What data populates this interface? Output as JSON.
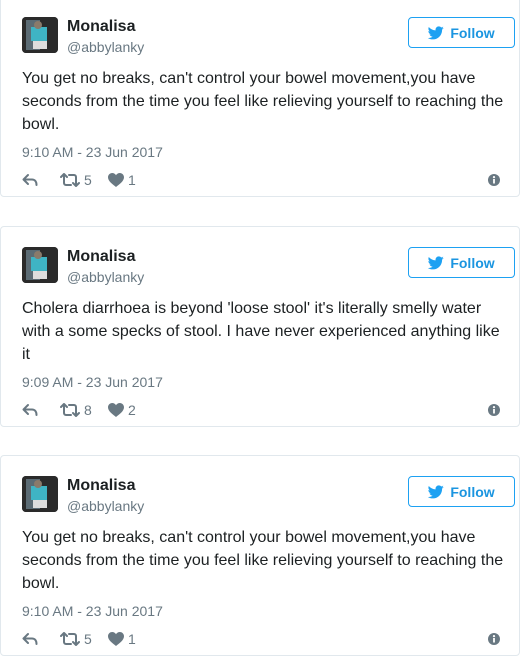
{
  "tweets": [
    {
      "name": "Monalisa",
      "handle": "@abbylanky",
      "follow_label": "Follow",
      "text": "You get no breaks, can't control your bowel movement,you have seconds from the time you feel like relieving yourself to reaching the bowl.",
      "time": "9:10 AM - 23 Jun 2017",
      "retweets": "5",
      "likes": "1"
    },
    {
      "name": "Monalisa",
      "handle": "@abbylanky",
      "follow_label": "Follow",
      "text": "Cholera diarrhoea is beyond 'loose stool' it's literally smelly water with a some specks of stool. I have never experienced anything like it",
      "time": "9:09 AM - 23 Jun 2017",
      "retweets": "8",
      "likes": "2"
    },
    {
      "name": "Monalisa",
      "handle": "@abbylanky",
      "follow_label": "Follow",
      "text": "You get no breaks, can't control your bowel movement,you have seconds from the time you feel like relieving yourself to reaching the bowl.",
      "time": "9:10 AM - 23 Jun 2017",
      "retweets": "5",
      "likes": "1"
    }
  ],
  "icons": {
    "follow": "twitter-bird-icon",
    "reply": "reply-icon",
    "retweet": "retweet-icon",
    "like": "heart-icon",
    "info": "info-icon"
  },
  "colors": {
    "accent": "#1da1f2",
    "accent_text": "#1b95e0",
    "text": "#1c2022",
    "muted": "#697882",
    "border": "#e1e8ed"
  }
}
